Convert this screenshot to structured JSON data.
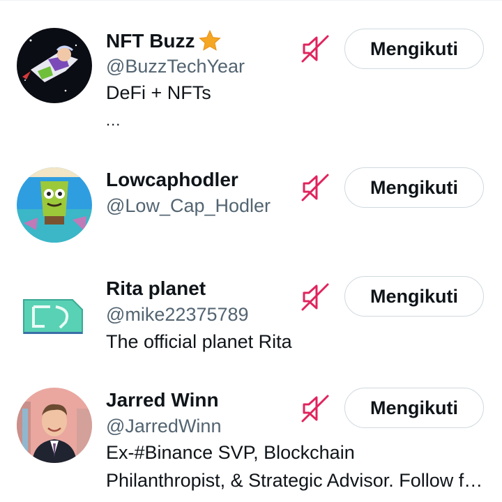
{
  "colors": {
    "mute_icon": "#e0245e",
    "verified_star": "#f5a623",
    "handle": "#536471",
    "button_border": "#cfd9de"
  },
  "icons": {
    "mute": "speaker-muted-icon",
    "badge": "star-badge-icon"
  },
  "users": [
    {
      "name": "NFT Buzz",
      "handle": "@BuzzTechYear",
      "bio": [
        "DeFi + NFTs"
      ],
      "more": "...",
      "follow_label": "Mengikuti",
      "badge": true
    },
    {
      "name": "Lowcaphodler",
      "handle": "@Low_Cap_Hodler",
      "bio": [],
      "follow_label": "Mengikuti"
    },
    {
      "name": "Rita planet",
      "handle": "@mike22375789",
      "bio": [
        "The official planet Rita"
      ],
      "follow_label": "Mengikuti"
    },
    {
      "name": "Jarred Winn",
      "handle": "@JarredWinn",
      "bio": [
        "Ex-#Binance SVP, Blockchain",
        "Philanthropist, & Strategic Advisor. Follow for..."
      ],
      "follow_label": "Mengikuti"
    }
  ]
}
